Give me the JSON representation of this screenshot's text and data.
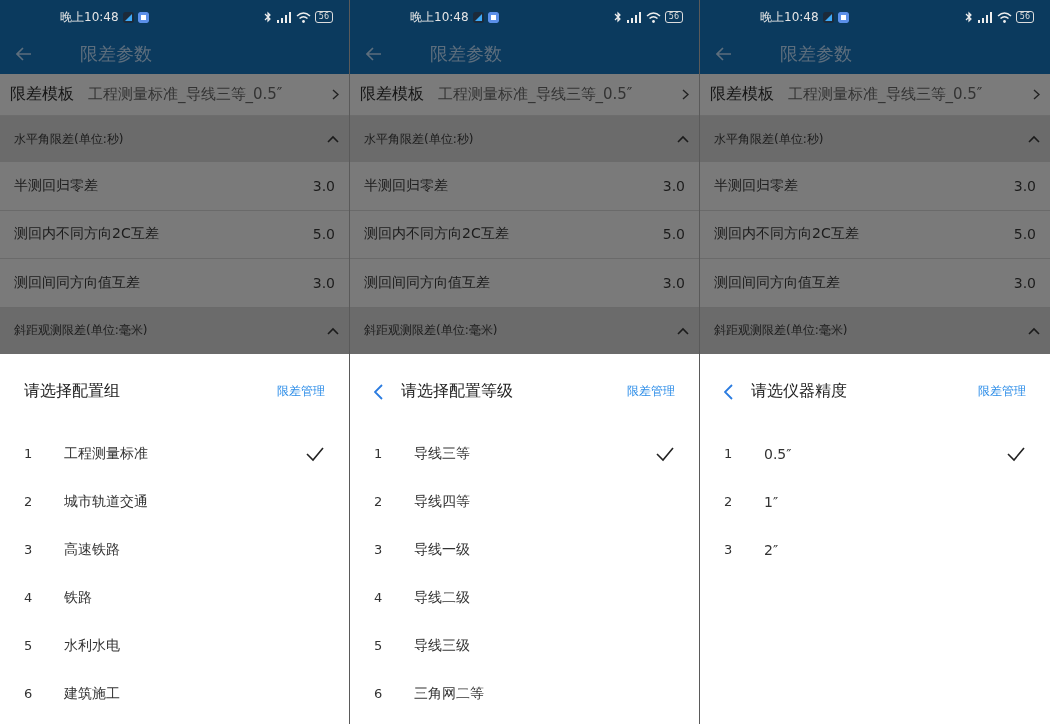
{
  "screens": [
    {
      "status_bar": {
        "time": "晚上10:48",
        "battery": "56"
      },
      "app_bar": {
        "title": "限差参数"
      },
      "template": {
        "label": "限差模板",
        "value": "工程测量标准_导线三等_0.5″"
      },
      "sections": [
        {
          "title": "水平角限差(单位:秒)",
          "expanded": true,
          "rows": [
            {
              "label": "半测回归零差",
              "value": "3.0"
            },
            {
              "label": "测回内不同方向2C互差",
              "value": "5.0"
            },
            {
              "label": "测回间同方向值互差",
              "value": "3.0"
            }
          ]
        },
        {
          "title": "斜距观测限差(单位:毫米)",
          "expanded": true
        }
      ],
      "sheet": {
        "has_back": false,
        "title": "请选择配置组",
        "action": "限差管理",
        "options": [
          {
            "index": "1",
            "label": "工程测量标准",
            "selected": true
          },
          {
            "index": "2",
            "label": "城市轨道交通",
            "selected": false
          },
          {
            "index": "3",
            "label": "高速铁路",
            "selected": false
          },
          {
            "index": "4",
            "label": "铁路",
            "selected": false
          },
          {
            "index": "5",
            "label": "水利水电",
            "selected": false
          },
          {
            "index": "6",
            "label": "建筑施工",
            "selected": false
          }
        ]
      }
    },
    {
      "status_bar": {
        "time": "晚上10:48",
        "battery": "56"
      },
      "app_bar": {
        "title": "限差参数"
      },
      "template": {
        "label": "限差模板",
        "value": "工程测量标准_导线三等_0.5″"
      },
      "sections": [
        {
          "title": "水平角限差(单位:秒)",
          "expanded": true,
          "rows": [
            {
              "label": "半测回归零差",
              "value": "3.0"
            },
            {
              "label": "测回内不同方向2C互差",
              "value": "5.0"
            },
            {
              "label": "测回间同方向值互差",
              "value": "3.0"
            }
          ]
        },
        {
          "title": "斜距观测限差(单位:毫米)",
          "expanded": true
        }
      ],
      "sheet": {
        "has_back": true,
        "title": "请选择配置等级",
        "action": "限差管理",
        "options": [
          {
            "index": "1",
            "label": "导线三等",
            "selected": true
          },
          {
            "index": "2",
            "label": "导线四等",
            "selected": false
          },
          {
            "index": "3",
            "label": "导线一级",
            "selected": false
          },
          {
            "index": "4",
            "label": "导线二级",
            "selected": false
          },
          {
            "index": "5",
            "label": "导线三级",
            "selected": false
          },
          {
            "index": "6",
            "label": "三角网二等",
            "selected": false
          }
        ]
      }
    },
    {
      "status_bar": {
        "time": "晚上10:48",
        "battery": "56"
      },
      "app_bar": {
        "title": "限差参数"
      },
      "template": {
        "label": "限差模板",
        "value": "工程测量标准_导线三等_0.5″"
      },
      "sections": [
        {
          "title": "水平角限差(单位:秒)",
          "expanded": true,
          "rows": [
            {
              "label": "半测回归零差",
              "value": "3.0"
            },
            {
              "label": "测回内不同方向2C互差",
              "value": "5.0"
            },
            {
              "label": "测回间同方向值互差",
              "value": "3.0"
            }
          ]
        },
        {
          "title": "斜距观测限差(单位:毫米)",
          "expanded": true
        }
      ],
      "sheet": {
        "has_back": true,
        "title": "请选仪器精度",
        "action": "限差管理",
        "options": [
          {
            "index": "1",
            "label": "0.5″",
            "selected": true
          },
          {
            "index": "2",
            "label": "1″",
            "selected": false
          },
          {
            "index": "3",
            "label": "2″",
            "selected": false
          }
        ]
      }
    }
  ]
}
